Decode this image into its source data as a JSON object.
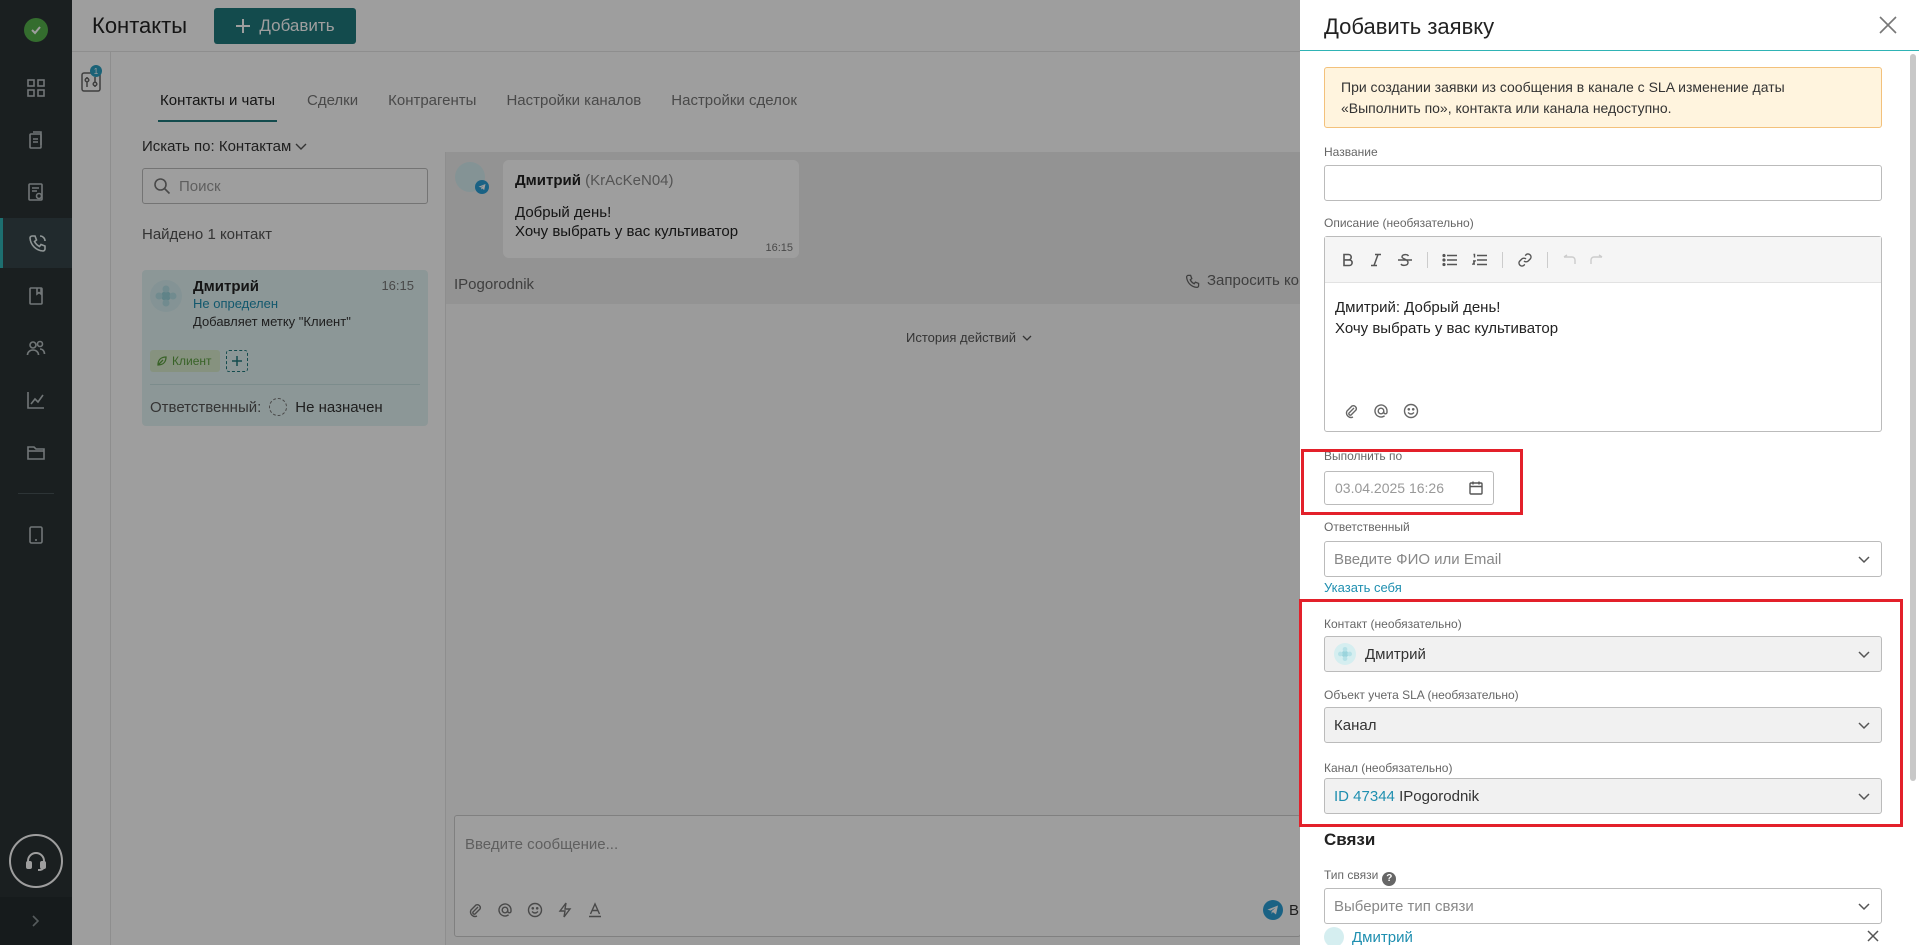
{
  "sidebar": {
    "items": [
      {
        "icon": "dashboard-icon"
      },
      {
        "icon": "clipboard-icon"
      },
      {
        "icon": "report-icon"
      },
      {
        "icon": "phone-icon"
      },
      {
        "icon": "book-icon"
      },
      {
        "icon": "users-icon"
      },
      {
        "icon": "chart-icon"
      },
      {
        "icon": "folder-icon"
      },
      {
        "icon": "tablet-icon"
      }
    ],
    "active": "phone-icon"
  },
  "app": {
    "title": "Контакты",
    "add_label": "Добавить",
    "filter_badge": "1",
    "tabs": [
      "Контакты и чаты",
      "Сделки",
      "Контрагенты",
      "Настройки каналов",
      "Настройки сделок"
    ],
    "search_by": "Искать по: Контактам",
    "search_placeholder": "Поиск",
    "found": "Найдено 1 контакт",
    "contact": {
      "name": "Дмитрий",
      "time": "16:15",
      "status": "Не определен",
      "action": "Добавляет метку \"Клиент\"",
      "tag": "Клиент",
      "responsible_label": "Ответственный:",
      "responsible_value": "Не назначен"
    },
    "chat": {
      "sender": "Дмитрий",
      "sender_id": "(KrAcKeN04)",
      "line1": "Добрый день!",
      "line2": "Хочу выбрать у вас культиватор",
      "time": "16:15",
      "source": "IPogorodnik",
      "request": "Запросить ко",
      "history": "История действий",
      "composer_placeholder": "Введите сообщение...",
      "send": "В"
    }
  },
  "drawer": {
    "title": "Добавить заявку",
    "warning": "При создании заявки из сообщения в канале с SLA изменение даты «Выполнить по», контакта или канала недоступно.",
    "name_label": "Название",
    "name_value": "",
    "desc_label": "Описание (необязательно)",
    "desc_line1": "Дмитрий: Добрый день!",
    "desc_line2": "Хочу выбрать у вас культиватор",
    "due_label": "Выполнить по",
    "due_value": "03.04.2025 16:26",
    "resp_label": "Ответственный",
    "resp_placeholder": "Введите ФИО или Email",
    "assign_self": "Указать себя",
    "contact_label": "Контакт (необязательно)",
    "contact_value": "Дмитрий",
    "sla_label": "Объект учета SLA (необязательно)",
    "sla_value": "Канал",
    "channel_label": "Канал (необязательно)",
    "channel_id": "ID 47344",
    "channel_name": "IPogorodnik",
    "links_title": "Связи",
    "link_type_label": "Тип связи",
    "link_type_placeholder": "Выберите тип связи",
    "linked_contact": "Дмитрий"
  },
  "colors": {
    "sidebar_bg": "#2b3335",
    "accent": "#1f7a7d",
    "link": "#1f8fb0",
    "warning_bg": "#fff4de",
    "highlight": "#e3202a"
  }
}
